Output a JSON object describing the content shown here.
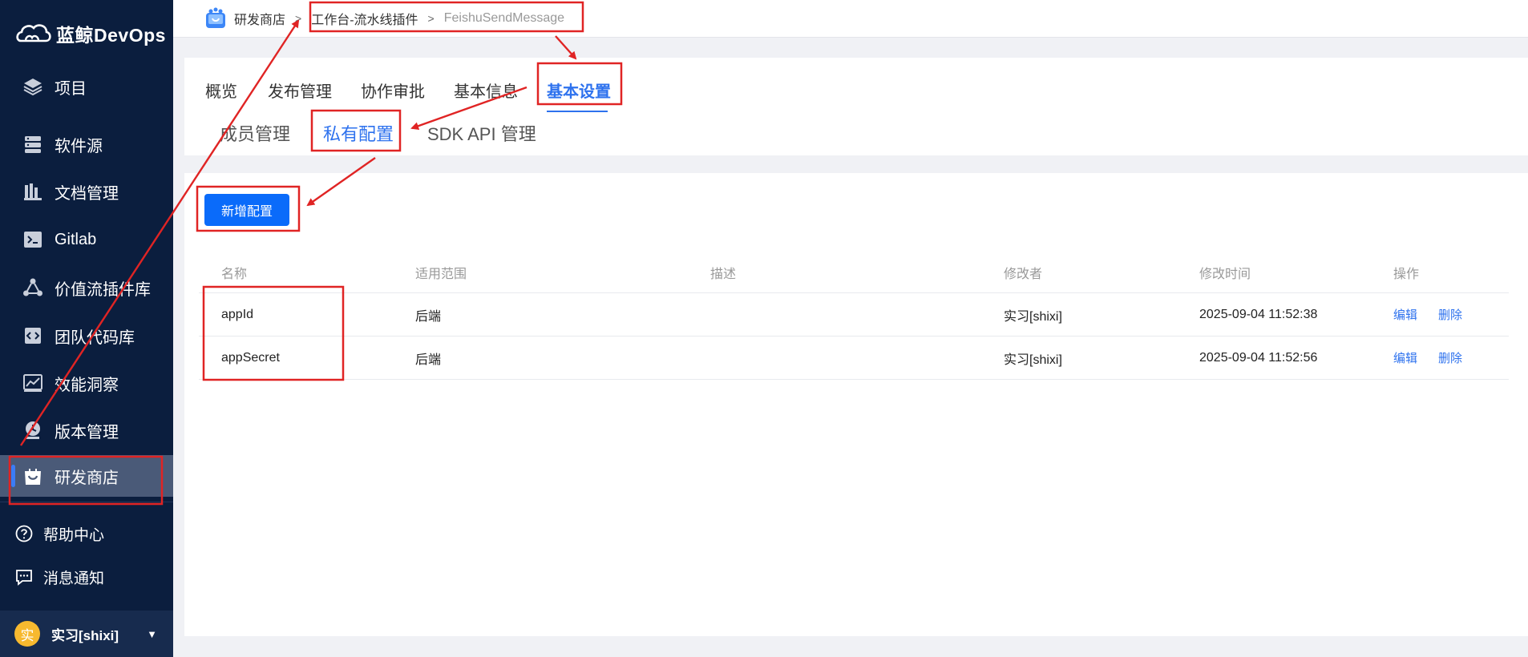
{
  "app": {
    "brand": "蓝鲸DevOps"
  },
  "sidebar": {
    "items": [
      {
        "label": "项目",
        "icon": "layers-icon"
      },
      {
        "label": "软件源",
        "icon": "server-icon"
      },
      {
        "label": "文档管理",
        "icon": "docs-icon"
      },
      {
        "label": "Gitlab",
        "icon": "terminal-icon"
      },
      {
        "label": "价值流插件库",
        "icon": "share-nodes-icon"
      },
      {
        "label": "团队代码库",
        "icon": "code-icon"
      },
      {
        "label": "效能洞察",
        "icon": "chart-line-icon"
      },
      {
        "label": "版本管理",
        "icon": "version-icon"
      },
      {
        "label": "研发商店",
        "icon": "shopping-bag-icon"
      }
    ],
    "active_item": "研发商店",
    "util": [
      {
        "label": "帮助中心",
        "icon": "help-circle-icon"
      },
      {
        "label": "消息通知",
        "icon": "message-icon"
      }
    ],
    "user": {
      "avatar_text": "实",
      "name": "实习[shixi]"
    }
  },
  "breadcrumb": {
    "root": "研发商店",
    "middle": "工作台-流水线插件",
    "current": "FeishuSendMessage"
  },
  "tabs": {
    "primary": [
      "概览",
      "发布管理",
      "协作审批",
      "基本信息",
      "基本设置"
    ],
    "primary_active": "基本设置",
    "secondary": [
      "成员管理",
      "私有配置",
      "SDK API 管理"
    ],
    "secondary_active": "私有配置"
  },
  "content": {
    "add_button": "新增配置",
    "columns": [
      "名称",
      "适用范围",
      "描述",
      "修改者",
      "修改时间",
      "操作"
    ],
    "rows": [
      {
        "name": "appId",
        "scope": "后端",
        "desc": "",
        "modifier": "实习[shixi]",
        "time": "2025-09-04 11:52:38",
        "edit": "编辑",
        "delete": "删除"
      },
      {
        "name": "appSecret",
        "scope": "后端",
        "desc": "",
        "modifier": "实习[shixi]",
        "time": "2025-09-04 11:52:56",
        "edit": "编辑",
        "delete": "删除"
      }
    ]
  },
  "colors": {
    "sidebar_bg": "#0b1e3e",
    "accent": "#2e72ee",
    "primary_button": "#0a6bfa",
    "annotation": "#e02424"
  }
}
